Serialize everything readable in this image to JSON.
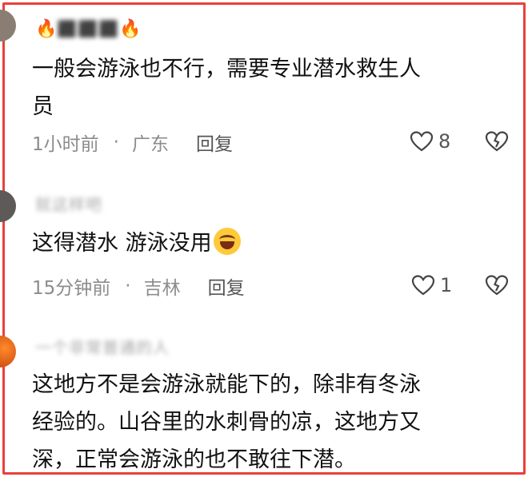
{
  "comments": [
    {
      "username": "⬛⬛⬛",
      "text_line1": "一般会游泳也不行，需要专业潜水救生人",
      "text_line2": "员",
      "time": "1小时前",
      "separator": "·",
      "location": "广东",
      "reply_label": "回复",
      "likes": "8",
      "like_icon": "heart-outline-icon",
      "dislike_icon": "broken-heart-icon"
    },
    {
      "username": "就这样吧",
      "text": "这得潜水 游泳没用",
      "emoji": "laughing-tears-emoji",
      "time": "15分钟前",
      "separator": "·",
      "location": "吉林",
      "reply_label": "回复",
      "likes": "1",
      "like_icon": "heart-outline-icon",
      "dislike_icon": "broken-heart-icon"
    },
    {
      "username": "一个非常普通的人",
      "text_line1": "这地方不是会游泳就能下的，除非有冬泳",
      "text_line2": "经验的。山谷里的水刺骨的凉，这地方又",
      "text_line3": "深，正常会游泳的也不敢往下潜。"
    }
  ],
  "colors": {
    "frame": "#e8413a",
    "meta_text": "#8c8c8c",
    "body_text": "#111111"
  }
}
